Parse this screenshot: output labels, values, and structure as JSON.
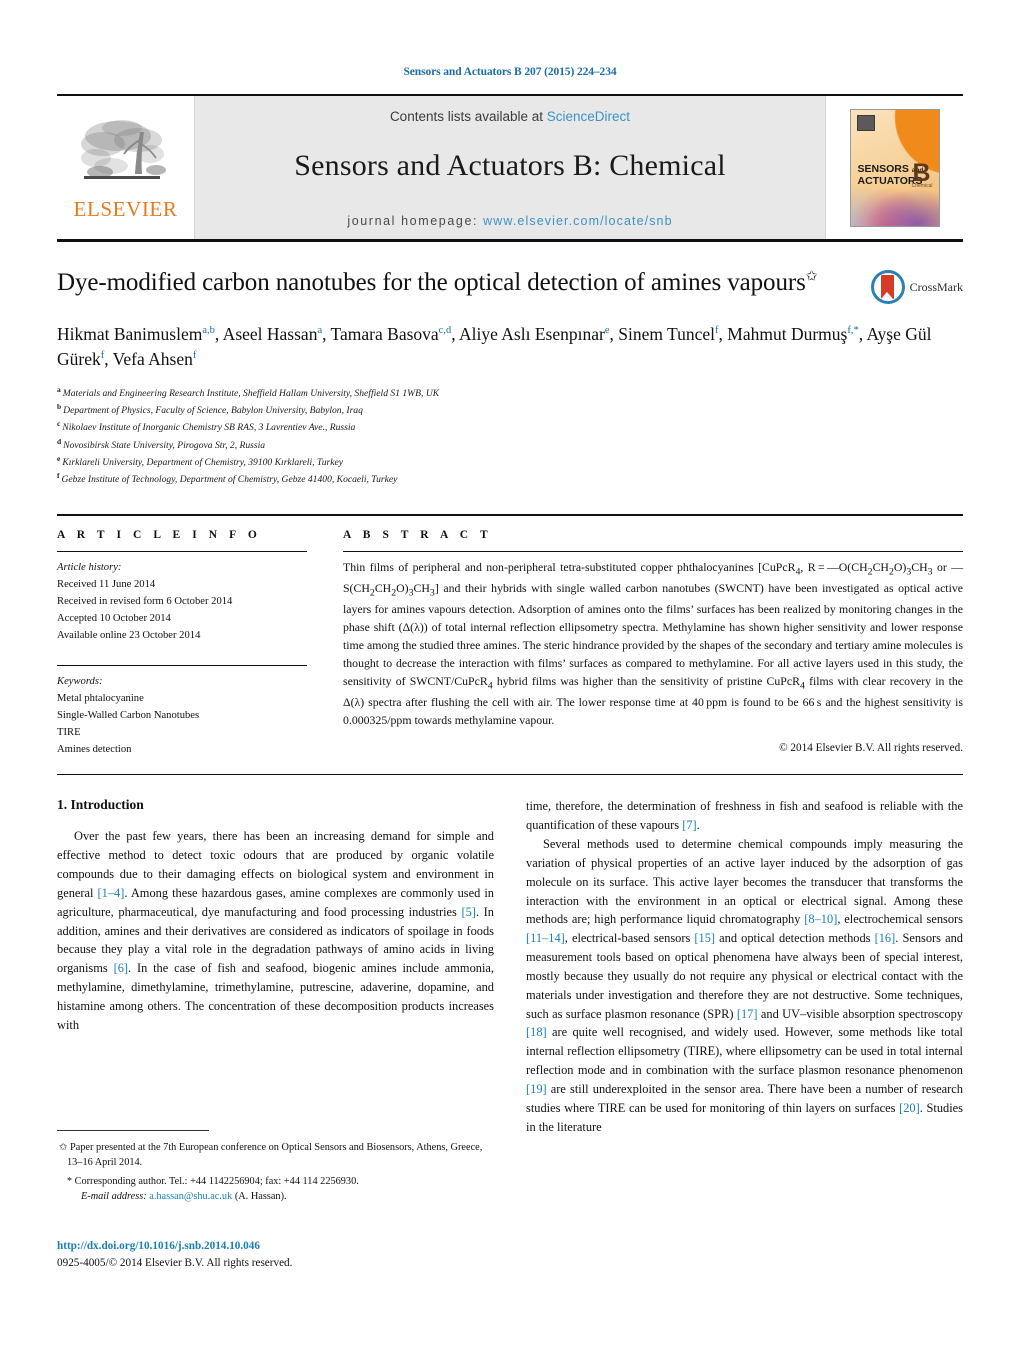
{
  "running_head": "Sensors and Actuators B 207 (2015) 224–234",
  "masthead": {
    "contents_prefix": "Contents lists available at ",
    "contents_link": "ScienceDirect",
    "journal_title": "Sensors and Actuators B: Chemical",
    "homepage_prefix": "journal homepage: ",
    "homepage_url": "www.elsevier.com/locate/snb",
    "publisher_logo_word": "ELSEVIER",
    "cover": {
      "line1": "SENSORS",
      "line1_small": "and",
      "line2": "ACTUATORS",
      "letter": "B",
      "subject": "Chemical"
    }
  },
  "article": {
    "title": "Dye-modified carbon nanotubes for the optical detection of amines vapours",
    "title_marker": "✩",
    "crossmark_label": "CrossMark",
    "authors_html": "Hikmat Banimuslem<sup>a,b</sup>, Aseel Hassan<sup>a</sup>, Tamara Basova<sup>c,d</sup>, Aliye Aslı Esenpınar<sup>e</sup>, Sinem Tuncel<sup>f</sup>, Mahmut Durmuş<sup>f,*</sup>, Ayşe Gül Gürek<sup>f</sup>, Vefa Ahsen<sup>f</sup>",
    "affiliations": [
      {
        "mark": "a",
        "text": "Materials and Engineering Research Institute, Sheffield Hallam University, Sheffield S1 1WB, UK"
      },
      {
        "mark": "b",
        "text": "Department of Physics, Faculty of Science, Babylon University, Babylon, Iraq"
      },
      {
        "mark": "c",
        "text": "Nikolaev Institute of Inorganic Chemistry SB RAS, 3 Lavrentiev Ave., Russia"
      },
      {
        "mark": "d",
        "text": "Novosibirsk State University, Pirogova Str, 2, Russia"
      },
      {
        "mark": "e",
        "text": "Kırklareli University, Department of Chemistry, 39100 Kırklareli, Turkey"
      },
      {
        "mark": "f",
        "text": "Gebze Institute of Technology, Department of Chemistry, Gebze 41400, Kocaeli, Turkey"
      }
    ]
  },
  "article_info": {
    "heading": "A R T I C L E   I N F O",
    "history_label": "Article history:",
    "history": [
      "Received 11 June 2014",
      "Received in revised form 6 October 2014",
      "Accepted 10 October 2014",
      "Available online 23 October 2014"
    ],
    "keywords_label": "Keywords:",
    "keywords": [
      "Metal phtalocyanine",
      "Single-Walled Carbon Nanotubes",
      "TIRE",
      "Amines detection"
    ]
  },
  "abstract": {
    "heading": "A B S T R A C T",
    "body_html": "Thin films of peripheral and non-peripheral tetra-substituted copper phthalocyanines [CuPcR<sub>4</sub>, R&#8201;=&#8201;—O(CH<sub>2</sub>CH<sub>2</sub>O)<sub>3</sub>CH<sub>3</sub> or —S(CH<sub>2</sub>CH<sub>2</sub>O)<sub>3</sub>CH<sub>3</sub>] and their hybrids with single walled carbon nanotubes (SWCNT) have been investigated as optical active layers for amines vapours detection. Adsorption of amines onto the films&#8217; surfaces has been realized by monitoring changes in the phase shift (&#916;(&#955;)) of total internal reflection ellipsometry spectra. Methylamine has shown higher sensitivity and lower response time among the studied three amines. The steric hindrance provided by the shapes of the secondary and tertiary amine molecules is thought to decrease the interaction with films&#8217; surfaces as compared to methylamine. For all active layers used in this study, the sensitivity of SWCNT/CuPcR<sub>4</sub> hybrid films was higher than the sensitivity of pristine CuPcR<sub>4</sub> films with clear recovery in the &#916;(&#955;) spectra after flushing the cell with air. The lower response time at 40&#8201;ppm is found to be 66&#8201;s and the highest sensitivity is 0.000325/ppm towards methylamine vapour.",
    "copyright": "© 2014 Elsevier B.V. All rights reserved."
  },
  "introduction": {
    "heading": "1.  Introduction",
    "left_paragraphs_html": [
      "Over the past few years, there has been an increasing demand for simple and effective method to detect toxic odours that are produced by organic volatile compounds due to their damaging effects on biological system and environment in general <span class=\"ref\">[1–4]</span>. Among these hazardous gases, amine complexes are commonly used in agriculture, pharmaceutical, dye manufacturing and food processing industries <span class=\"ref\">[5]</span>. In addition, amines and their derivatives are considered as indicators of spoilage in foods because they play a vital role in the degradation pathways of amino acids in living organisms <span class=\"ref\">[6]</span>. In the case of fish and seafood, biogenic amines include ammonia, methylamine, dimethylamine, trimethylamine, putrescine, adaverine, dopamine, and histamine among others. The concentration of these decomposition products increases with"
    ],
    "right_paragraphs_html": [
      "time, therefore, the determination of freshness in fish and seafood is reliable with the quantification of these vapours <span class=\"ref\">[7]</span>.",
      "Several methods used to determine chemical compounds imply measuring the variation of physical properties of an active layer induced by the adsorption of gas molecule on its surface. This active layer becomes the transducer that transforms the interaction with the environment in an optical or electrical signal. Among these methods are; high performance liquid chromatography <span class=\"ref\">[8–10]</span>, electrochemical sensors <span class=\"ref\">[11–14]</span>, electrical-based sensors <span class=\"ref\">[15]</span> and optical detection methods <span class=\"ref\">[16]</span>. Sensors and measurement tools based on optical phenomena have always been of special interest, mostly because they usually do not require any physical or electrical contact with the materials under investigation and therefore they are not destructive. Some techniques, such as surface plasmon resonance (SPR) <span class=\"ref\">[17]</span> and UV–visible absorption spectroscopy <span class=\"ref\">[18]</span> are quite well recognised, and widely used. However, some methods like total internal reflection ellipsometry (TIRE), where ellipsometry can be used in total internal reflection mode and in combination with the surface plasmon resonance phenomenon <span class=\"ref\">[19]</span> are still underexploited in the sensor area. There have been a number of research studies where TIRE can be used for monitoring of thin layers on surfaces <span class=\"ref\">[20]</span>. Studies in the literature"
    ]
  },
  "footnotes": {
    "conference_mark": "✩",
    "conference_text": "Paper presented at the 7th European conference on Optical Sensors and Biosensors, Athens, Greece, 13–16 April 2014.",
    "corresponding_mark": "*",
    "corresponding_text": "Corresponding author. Tel.: +44 1142256904; fax: +44 114 2256930.",
    "email_label": "E-mail address:",
    "email": "a.hassan@shu.ac.uk",
    "email_owner": "(A. Hassan).",
    "doi": "http://dx.doi.org/10.1016/j.snb.2014.10.046",
    "issn_line": "0925-4005/© 2014 Elsevier B.V. All rights reserved."
  },
  "colors": {
    "link": "#1a7fb5",
    "running_head": "#1a6fa8",
    "sciencedirect": "#3b93c4",
    "elsevier_orange": "#e87a1e",
    "band_gray": "#e8e8e8"
  }
}
